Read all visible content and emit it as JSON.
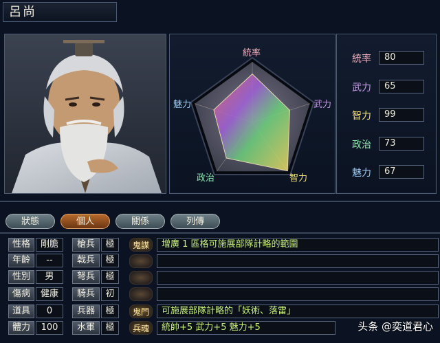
{
  "character": {
    "name": "呂尚"
  },
  "radar": {
    "labels": {
      "tong": "統率",
      "wu": "武力",
      "zhi": "智力",
      "zheng": "政治",
      "mei": "魅力"
    },
    "values": {
      "tong": 80,
      "wu": 65,
      "zhi": 99,
      "zheng": 73,
      "mei": 67
    },
    "max": 100,
    "label_colors": {
      "tong": "#f0b0bd",
      "wu": "#c79ae9",
      "zhi": "#f3e37a",
      "zheng": "#8ee5b0",
      "mei": "#9cc8f2"
    }
  },
  "stats": [
    {
      "label": "統率",
      "value": "80",
      "color": "#f0b0bd"
    },
    {
      "label": "武力",
      "value": "65",
      "color": "#c79ae9"
    },
    {
      "label": "智力",
      "value": "99",
      "color": "#f3e37a"
    },
    {
      "label": "政治",
      "value": "73",
      "color": "#8ee5b0"
    },
    {
      "label": "魅力",
      "value": "67",
      "color": "#9cc8f2"
    }
  ],
  "tabs": [
    {
      "label": "狀態",
      "active": false
    },
    {
      "label": "個人",
      "active": true
    },
    {
      "label": "關係",
      "active": false
    },
    {
      "label": "列傳",
      "active": false
    }
  ],
  "profile": [
    {
      "label": "性格",
      "value": "剛膽"
    },
    {
      "label": "年齡",
      "value": "--"
    },
    {
      "label": "性別",
      "value": "男"
    },
    {
      "label": "傷病",
      "value": "健康"
    },
    {
      "label": "道具",
      "value": "0"
    },
    {
      "label": "體力",
      "value": "100"
    }
  ],
  "aptitude": [
    {
      "label": "槍兵",
      "value": "極"
    },
    {
      "label": "戟兵",
      "value": "極"
    },
    {
      "label": "弩兵",
      "value": "極"
    },
    {
      "label": "騎兵",
      "value": "初"
    },
    {
      "label": "兵器",
      "value": "極"
    },
    {
      "label": "水軍",
      "value": "極"
    }
  ],
  "skills": [
    {
      "icon": "鬼謀",
      "text": "增廣 1 區格可施展部隊計略的範圍"
    },
    {
      "icon": "",
      "text": ""
    },
    {
      "icon": "",
      "text": ""
    },
    {
      "icon": "",
      "text": ""
    },
    {
      "icon": "鬼門",
      "text": "可施展部隊計略的「妖術、落雷」"
    },
    {
      "icon": "兵魂",
      "text": "統帥+5 武力+5 魅力+5"
    }
  ],
  "watermark": "头条 @奕道君心"
}
